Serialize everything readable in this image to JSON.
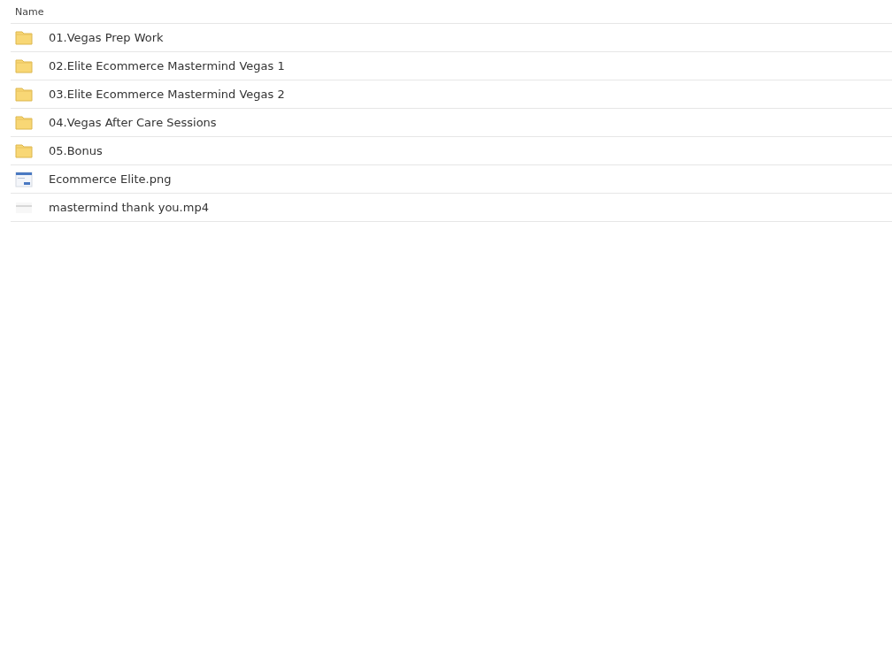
{
  "table": {
    "columns": [
      "Name"
    ],
    "rows": [
      {
        "kind": "folder",
        "name": "01.Vegas Prep Work"
      },
      {
        "kind": "folder",
        "name": "02.Elite Ecommerce Mastermind Vegas 1"
      },
      {
        "kind": "folder",
        "name": "03.Elite Ecommerce Mastermind Vegas 2"
      },
      {
        "kind": "folder",
        "name": "04.Vegas After Care Sessions"
      },
      {
        "kind": "folder",
        "name": "05.Bonus"
      },
      {
        "kind": "image",
        "name": "Ecommerce Elite.png"
      },
      {
        "kind": "video",
        "name": "mastermind thank you.mp4"
      }
    ]
  }
}
